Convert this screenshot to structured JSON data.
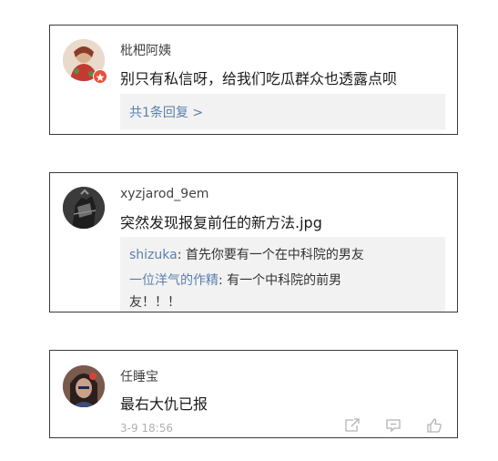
{
  "comments": [
    {
      "username": "枇杷阿姨",
      "text": "别只有私信呀，给我们吃瓜群众也透露点呗",
      "reply_link": "共1条回复 >"
    },
    {
      "username": "xyzjarod_9em",
      "text": "突然发现报复前任的新方法.jpg",
      "replies": [
        {
          "user": "shizuka",
          "sep": ": ",
          "text": "首先你要有一个在中科院的男友"
        },
        {
          "user": "一位洋气的作精",
          "sep": ": ",
          "text": "有一个中科院的前男",
          "text_cont": "友！！！"
        }
      ]
    },
    {
      "username": "任睡宝",
      "text": "最右大仇已报",
      "time": "3-9 18:56"
    }
  ],
  "icons": {
    "share": "share-icon",
    "comment": "comment-icon",
    "like": "thumbs-up-icon",
    "badge": "vip-badge-icon"
  },
  "colors": {
    "link": "#5b7fae",
    "reply_bg": "#f2f2f2",
    "badge": "#e8513a",
    "muted": "#b0b0b0"
  }
}
